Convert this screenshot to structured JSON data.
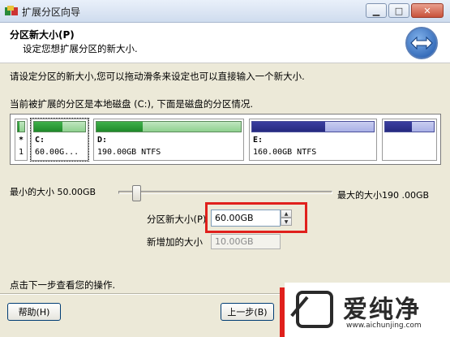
{
  "window": {
    "title": "扩展分区向导",
    "min_glyph": "▁",
    "max_glyph": "□",
    "close_glyph": "✕"
  },
  "header": {
    "title": "分区新大小(P)",
    "subtitle": "设定您想扩展分区的新大小."
  },
  "instruction": "请设定分区的新大小,您可以拖动滑条来设定也可以直接输入一个新大小.",
  "current_partition_text": "当前被扩展的分区是本地磁盘 (C:), 下面是磁盘的分区情况.",
  "disk_map": {
    "partitions": [
      {
        "line1": "*",
        "line2": "1",
        "color": "green",
        "used": 0.3
      },
      {
        "line1": "C:",
        "line2": "60.00G...",
        "color": "green",
        "used": 0.55
      },
      {
        "line1": "D:",
        "line2": "190.00GB NTFS",
        "color": "green",
        "used": 0.32
      },
      {
        "line1": "E:",
        "line2": "160.00GB NTFS",
        "color": "blue",
        "used": 0.6
      },
      {
        "line1": "",
        "line2": "",
        "color": "blue",
        "used": 0.55
      }
    ]
  },
  "slider": {
    "min_label": "最小的大小 50.00GB",
    "max_label": "最大的大小190 .00GB",
    "min_gb": 50,
    "max_gb": 190,
    "value_gb": 60
  },
  "size_field": {
    "label": "分区新大小(P)",
    "value": "60.00GB"
  },
  "added_field": {
    "label": "新增加的大小",
    "value": "10.00GB"
  },
  "footer_text": "点击下一步查看您的操作.",
  "buttons": {
    "help": "帮助(H)",
    "back": "上一步(B)"
  },
  "watermark": {
    "name": "爱纯净",
    "url": "www.aichunjing.com"
  },
  "colors": {
    "highlight": "#e0201c",
    "green_bar": "#1f8a2a",
    "blue_bar": "#262a80"
  }
}
